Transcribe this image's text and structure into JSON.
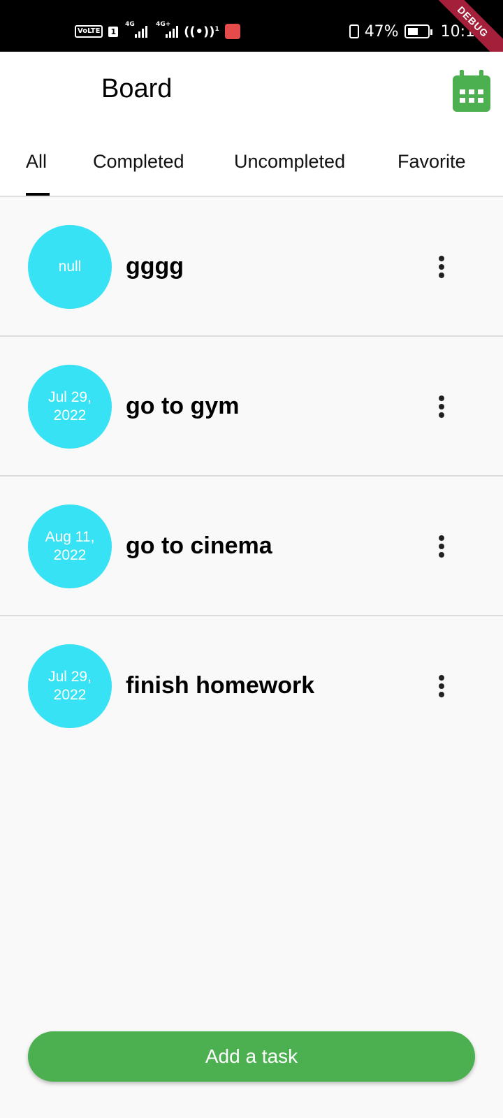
{
  "status_bar": {
    "volte": "VoLTE",
    "sim": "1",
    "net1": "4G",
    "net2": "4G+",
    "hotspot_badge": "1",
    "battery": "47%",
    "time": "10:1"
  },
  "debug_banner": "DEBUG",
  "app_bar": {
    "title": "Board",
    "calendar_icon": "calendar-icon",
    "accent_color": "#4caf50"
  },
  "tabs": [
    {
      "label": "All",
      "selected": true
    },
    {
      "label": "Completed",
      "selected": false
    },
    {
      "label": "Uncompleted",
      "selected": false
    },
    {
      "label": "Favorite",
      "selected": false
    }
  ],
  "tasks": [
    {
      "date_line1": "null",
      "date_line2": "",
      "title": "gggg"
    },
    {
      "date_line1": "Jul 29,",
      "date_line2": "2022",
      "title": "go to gym"
    },
    {
      "date_line1": "Aug 11,",
      "date_line2": "2022",
      "title": "go to cinema"
    },
    {
      "date_line1": "Jul 29,",
      "date_line2": "2022",
      "title": "finish homework"
    }
  ],
  "avatar_color": "#38e2f5",
  "add_button_label": "Add a task"
}
